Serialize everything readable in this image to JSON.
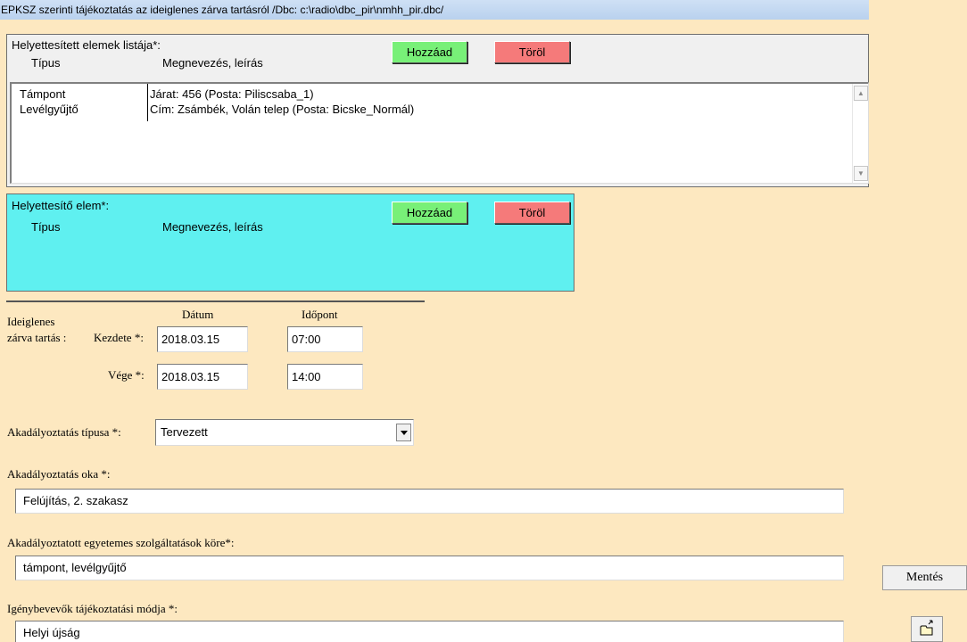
{
  "title": "EPKSZ szerinti tájékoztatás az ideiglenes zárva tartásról   /Dbc: c:\\radio\\dbc_pir\\nmhh_pir.dbc/",
  "replaced_panel": {
    "heading": "Helyettesített elemek listája*:",
    "col_type": "Típus",
    "col_name": "Megnevezés, leírás",
    "add_label": "Hozzáad",
    "delete_label": "Töröl",
    "rows": [
      {
        "type": "Támpont",
        "desc": "Járat: 456  (Posta: Piliscsaba_1)"
      },
      {
        "type": "Levélgyűjtő",
        "desc": "Cím: Zsámbék, Volán telep  (Posta: Bicske_Normál)"
      }
    ]
  },
  "replacement_panel": {
    "heading": "Helyettesítő elem*:",
    "col_type": "Típus",
    "col_name": "Megnevezés, leírás",
    "add_label": "Hozzáad",
    "delete_label": "Töröl"
  },
  "closure": {
    "label_line1": "Ideiglenes",
    "label_line2": "zárva tartás :",
    "date_header": "Dátum",
    "time_header": "Időpont",
    "start_label": "Kezdete *:",
    "end_label": "Vége *:",
    "start_date": "2018.03.15",
    "start_time": "07:00",
    "end_date": "2018.03.15",
    "end_time": "14:00"
  },
  "obstruction_type": {
    "label": "Akadályoztatás típusa *:",
    "value": "Tervezett"
  },
  "obstruction_reason": {
    "label": "Akadályoztatás oka *:",
    "value": "Felújítás, 2. szakasz"
  },
  "affected_services": {
    "label": "Akadályoztatott egyetemes szolgáltatások köre*:",
    "value": "támpont, levélgyűjtő"
  },
  "notification_method": {
    "label": "Igénybevevők tájékoztatási módja *:",
    "value": "Helyi újság"
  },
  "save_label": "Mentés",
  "colors": {
    "background": "#fde8c0",
    "replacement_panel": "#5ff0f0",
    "add_button": "#78f078",
    "delete_button": "#f57a7a"
  },
  "icons": {
    "scroll_up": "scroll-up-arrow",
    "scroll_down": "scroll-down-arrow",
    "dropdown": "chevron-down",
    "folder": "open-folder"
  }
}
